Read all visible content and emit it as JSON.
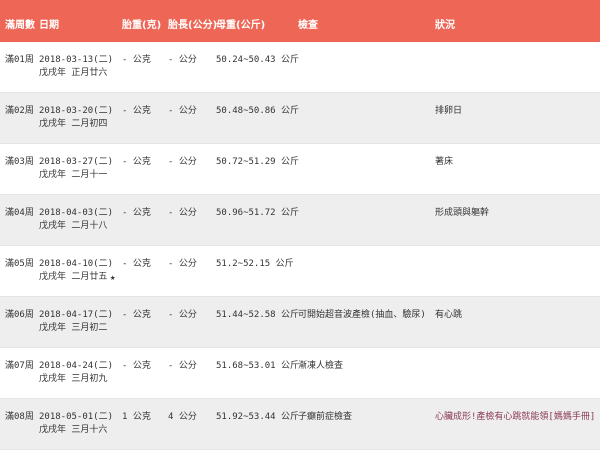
{
  "columns": {
    "week": "滿周數",
    "date": "日期",
    "fetal_weight": "胎重(克)",
    "fetal_length": "胎長(公分)",
    "mother_weight": "母重(公斤)",
    "check": "檢查",
    "status": "狀況"
  },
  "rows": [
    {
      "week": "滿01周",
      "date": "2018-03-13(二)",
      "lunar": "戊戌年 正月廿六",
      "star": "",
      "weight": "- 公克",
      "length": "- 公分",
      "mother": "50.24~50.43 公斤",
      "check": "",
      "status": ""
    },
    {
      "week": "滿02周",
      "date": "2018-03-20(二)",
      "lunar": "戊戌年 二月初四",
      "star": "",
      "weight": "- 公克",
      "length": "- 公分",
      "mother": "50.48~50.86 公斤",
      "check": "",
      "status": "排卵日"
    },
    {
      "week": "滿03周",
      "date": "2018-03-27(二)",
      "lunar": "戊戌年 二月十一",
      "star": "",
      "weight": "- 公克",
      "length": "- 公分",
      "mother": "50.72~51.29 公斤",
      "check": "",
      "status": "著床"
    },
    {
      "week": "滿04周",
      "date": "2018-04-03(二)",
      "lunar": "戊戌年 二月十八",
      "star": "",
      "weight": "- 公克",
      "length": "- 公分",
      "mother": "50.96~51.72 公斤",
      "check": "",
      "status": "形成頭與軀幹"
    },
    {
      "week": "滿05周",
      "date": "2018-04-10(二)",
      "lunar": "戊戌年 二月廿五",
      "star": "★",
      "weight": "- 公克",
      "length": "- 公分",
      "mother": "51.2~52.15 公斤",
      "check": "",
      "status": ""
    },
    {
      "week": "滿06周",
      "date": "2018-04-17(二)",
      "lunar": "戊戌年 三月初二",
      "star": "",
      "weight": "- 公克",
      "length": "- 公分",
      "mother": "51.44~52.58 公斤",
      "check": "可開始超音波產檢(抽血、驗尿)",
      "status": "有心跳"
    },
    {
      "week": "滿07周",
      "date": "2018-04-24(二)",
      "lunar": "戊戌年 三月初九",
      "star": "",
      "weight": "- 公克",
      "length": "- 公分",
      "mother": "51.68~53.01 公斤",
      "check": "漸凍人檢查",
      "status": ""
    },
    {
      "week": "滿08周",
      "date": "2018-05-01(二)",
      "lunar": "戊戌年 三月十六",
      "star": "",
      "weight": "1 公克",
      "length": "4 公分",
      "mother": "51.92~53.44 公斤",
      "check": "子癲前症檢查",
      "status": "心臟成形!產檢有心跳就能領[媽媽手冊]"
    }
  ]
}
